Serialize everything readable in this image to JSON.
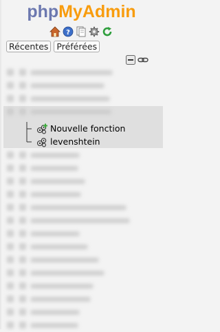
{
  "logo": {
    "part1": "php",
    "part2": "MyAdmin"
  },
  "toolbar_icons": [
    "home-icon",
    "help-icon",
    "docs-icon",
    "settings-icon",
    "reload-icon"
  ],
  "tabs": {
    "recent": "Récentes",
    "favorites": "Préférées"
  },
  "tree_controls": [
    "collapse-all-icon",
    "link-icon"
  ],
  "blurred_db_count_before": 4,
  "expanded_db": {
    "children": [
      {
        "label": "Nouvelle fonction",
        "icon": "new-function-icon"
      },
      {
        "label": "levenshtein",
        "icon": "function-icon"
      }
    ]
  },
  "blurred_db_count_after": 14,
  "colors": {
    "logo_php": "#6c78af",
    "logo_myadmin": "#f89c0e",
    "panel_bg": "#f3f3f3",
    "expanded_bg": "#dfdfdf"
  }
}
